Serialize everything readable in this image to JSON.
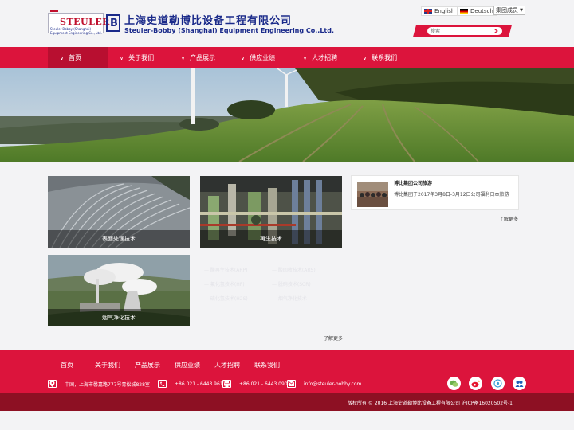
{
  "header": {
    "logo_text": "STEULER",
    "logo_sub": "Steuler-Bobby (Shanghai) Equipment Engineering Co., Ltd.",
    "company_cn": "上海史道勒博比设备工程有限公司",
    "company_en": "Steuler-Bobby (Shanghai) Equipment Engineering Co.,Ltd.",
    "lang_en": "English",
    "lang_de": "Deutsch",
    "group_select": "集团成员",
    "search_placeholder": "搜索"
  },
  "nav": {
    "items": [
      {
        "label": "首页"
      },
      {
        "label": "关于我们"
      },
      {
        "label": "产品展示"
      },
      {
        "label": "供应业绩"
      },
      {
        "label": "人才招聘"
      },
      {
        "label": "联系我们"
      }
    ]
  },
  "tiles": [
    {
      "caption": "表面处理技术"
    },
    {
      "caption": "再生技术"
    },
    {
      "caption": "烟气净化技术"
    }
  ],
  "tech_links": [
    "— 酸再生技术(ARP)",
    "— 酸回收技术(ARS)",
    "— 氟化氢技术(HF)",
    "— 脱硝技术(SCR)",
    "— 硫化氢技术(H2S)",
    "— 烟气净化技术"
  ],
  "more_left": "了解更多",
  "news": {
    "title": "博比集团公司旅游",
    "text": "博比集团于2017年3月8日-3月12日公司福利日本旅游",
    "more": "了解更多"
  },
  "footer": {
    "links": [
      "首页",
      "关于我们",
      "产品展示",
      "供应业绩",
      "人才招聘",
      "联系我们"
    ],
    "address": "中国，上海市馨嘉路777号青松城828室",
    "phone": "+86 021 - 6443 9611",
    "fax": "+86 021 - 6443 0902",
    "email": "info@steuler-bobby.com",
    "copyright": "版权所有 © 2016 上海史道勒博比设备工程有限公司 沪ICP备16020502号-1"
  },
  "colors": {
    "brand_red": "#dc143c",
    "nav_active": "#b80f30",
    "copyright_bar": "#8d1023",
    "brand_blue": "#1a2a8a"
  }
}
